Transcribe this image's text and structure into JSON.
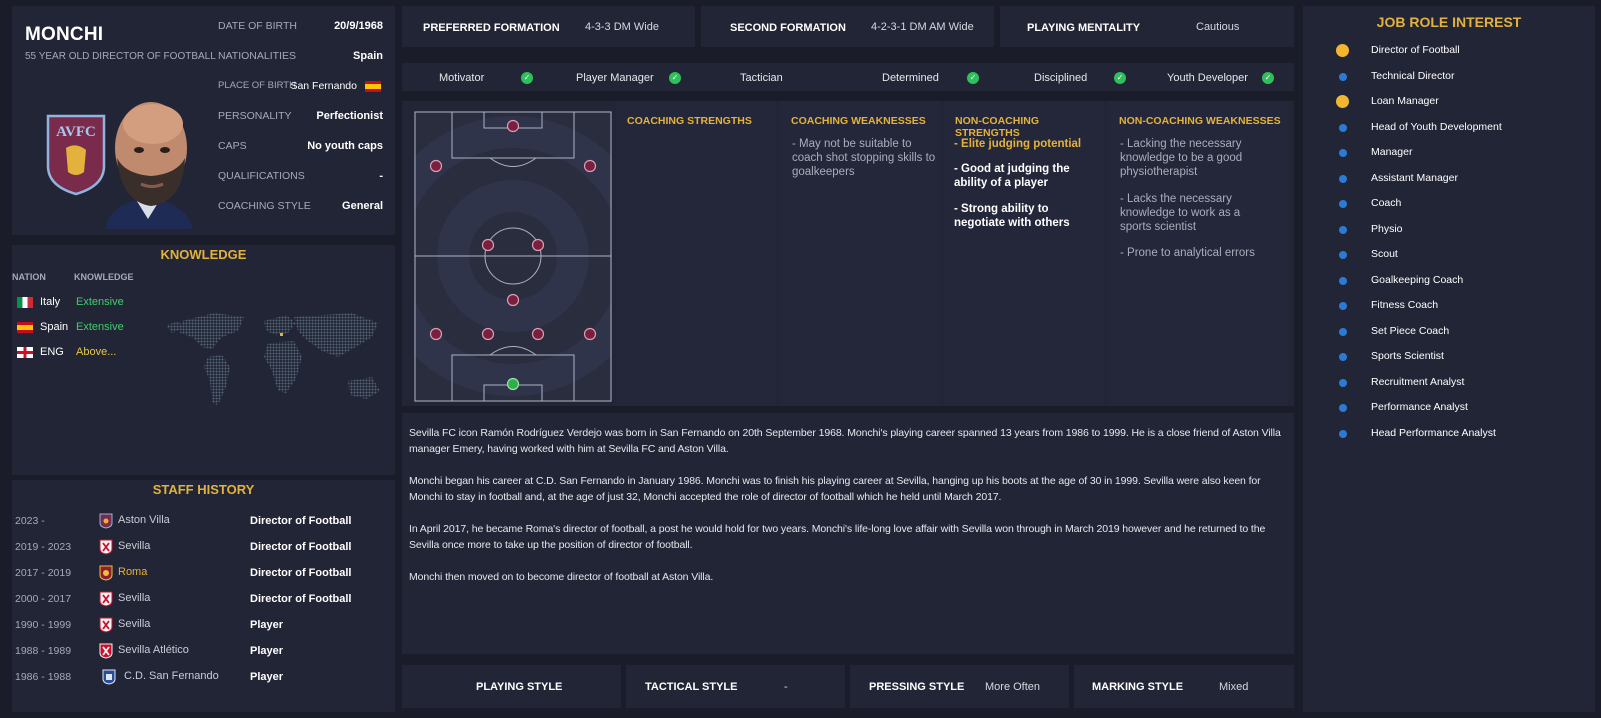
{
  "profile": {
    "name": "MONCHI",
    "subtitle": "55 YEAR OLD DIRECTOR OF FOOTBALL",
    "crest_text": "AVFC",
    "info": [
      {
        "label": "DATE OF BIRTH",
        "value": "20/9/1968"
      },
      {
        "label": "NATIONALITIES",
        "value": "Spain"
      },
      {
        "label": "PLACE OF BIRTH",
        "value": "San Fernando"
      },
      {
        "label": "PERSONALITY",
        "value": "Perfectionist"
      },
      {
        "label": "CAPS",
        "value": "No youth caps"
      },
      {
        "label": "QUALIFICATIONS",
        "value": "-"
      },
      {
        "label": "COACHING STYLE",
        "value": "General"
      }
    ]
  },
  "knowledge": {
    "title": "KNOWLEDGE",
    "col_nation": "NATION",
    "col_knowledge": "KNOWLEDGE",
    "rows": [
      {
        "nation": "Italy",
        "level": "Extensive",
        "color": "#3ecf6b"
      },
      {
        "nation": "Spain",
        "level": "Extensive",
        "color": "#3ecf6b"
      },
      {
        "nation": "ENG",
        "level": "Above...",
        "color": "#e6c84a"
      }
    ]
  },
  "history": {
    "title": "STAFF HISTORY",
    "rows": [
      {
        "years": "2023 -",
        "club": "Aston Villa",
        "role": "Director of Football",
        "club_color": "#c9ccd6"
      },
      {
        "years": "2019 - 2023",
        "club": "Sevilla",
        "role": "Director of Football",
        "club_color": "#c9ccd6"
      },
      {
        "years": "2017 - 2019",
        "club": "Roma",
        "role": "Director of Football",
        "club_color": "#e3b23c"
      },
      {
        "years": "2000 - 2017",
        "club": "Sevilla",
        "role": "Director of Football",
        "club_color": "#c9ccd6"
      },
      {
        "years": "1990 - 1999",
        "club": "Sevilla",
        "role": "Player",
        "club_color": "#c9ccd6"
      },
      {
        "years": "1988 - 1989",
        "club": "Sevilla Atlético",
        "role": "Player",
        "club_color": "#c9ccd6"
      },
      {
        "years": "1986 - 1988",
        "club": "C.D. San Fernando",
        "role": "Player",
        "club_color": "#c9ccd6"
      }
    ]
  },
  "formation": {
    "preferred_label": "PREFERRED FORMATION",
    "preferred_value": "4-3-3 DM Wide",
    "second_label": "SECOND FORMATION",
    "second_value": "4-2-3-1 DM AM Wide",
    "mentality_label": "PLAYING MENTALITY",
    "mentality_value": "Cautious"
  },
  "traits": [
    {
      "label": "Motivator",
      "ticked": true
    },
    {
      "label": "Player Manager",
      "ticked": true
    },
    {
      "label": "Tactician",
      "ticked": false
    },
    {
      "label": "Determined",
      "ticked": true
    },
    {
      "label": "Disciplined",
      "ticked": true
    },
    {
      "label": "Youth Developer",
      "ticked": true
    }
  ],
  "coaching": {
    "strengths_title": "COACHING STRENGTHS",
    "weaknesses_title": "COACHING WEAKNESSES",
    "weaknesses": [
      "- May not be suitable to coach shot stopping skills to goalkeepers"
    ],
    "nc_strengths_title": "NON-COACHING STRENGTHS",
    "nc_strengths": [
      {
        "text": "- Elite judging potential",
        "color": "#e3b23c"
      },
      {
        "text": "- Good at judging the ability of a player",
        "color": "#ffffff"
      },
      {
        "text": "- Strong ability to negotiate with others",
        "color": "#ffffff"
      }
    ],
    "nc_weaknesses_title": "NON-COACHING WEAKNESSES",
    "nc_weaknesses": [
      "- Lacking the necessary knowledge to be a good physiotherapist",
      "- Lacks the necessary knowledge to work as a sports scientist",
      "- Prone to analytical errors"
    ]
  },
  "bio": [
    "Sevilla FC icon Ramón Rodríguez Verdejo was born in San Fernando on 20th September 1968. Monchi's playing career spanned 13 years from 1986 to 1999. He is a close friend of Aston Villa manager Emery, having worked with him at Sevilla FC and Aston Villa.",
    "Monchi began his career at C.D. San Fernando in January 1986. Monchi was to finish his playing career at Sevilla, hanging up his boots at the age of 30 in 1999. Sevilla were also keen for Monchi to stay in football and, at the age of just 32, Monchi accepted the role of director of football which he held until March 2017.",
    "In April 2017, he became Roma's director of football, a post he would hold for two years. Monchi's life-long love affair with Sevilla won through in March 2019 however and he returned to the Sevilla once more to take up the position of director of football.",
    "Monchi then moved on to become director of football at Aston Villa."
  ],
  "styles": {
    "playing_label": "PLAYING STYLE",
    "playing_value": "",
    "tactical_label": "TACTICAL STYLE",
    "tactical_value": "-",
    "pressing_label": "PRESSING STYLE",
    "pressing_value": "More Often",
    "marking_label": "MARKING STYLE",
    "marking_value": "Mixed"
  },
  "job_roles": {
    "title": "JOB ROLE INTEREST",
    "items": [
      {
        "label": "Director of Football",
        "high": true
      },
      {
        "label": "Technical Director",
        "high": false
      },
      {
        "label": "Loan Manager",
        "high": true
      },
      {
        "label": "Head of Youth Development",
        "high": false
      },
      {
        "label": "Manager",
        "high": false
      },
      {
        "label": "Assistant Manager",
        "high": false
      },
      {
        "label": "Coach",
        "high": false
      },
      {
        "label": "Physio",
        "high": false
      },
      {
        "label": "Scout",
        "high": false
      },
      {
        "label": "Goalkeeping Coach",
        "high": false
      },
      {
        "label": "Fitness Coach",
        "high": false
      },
      {
        "label": "Set Piece Coach",
        "high": false
      },
      {
        "label": "Sports Scientist",
        "high": false
      },
      {
        "label": "Recruitment Analyst",
        "high": false
      },
      {
        "label": "Performance Analyst",
        "high": false
      },
      {
        "label": "Head Performance Analyst",
        "high": false
      }
    ]
  }
}
